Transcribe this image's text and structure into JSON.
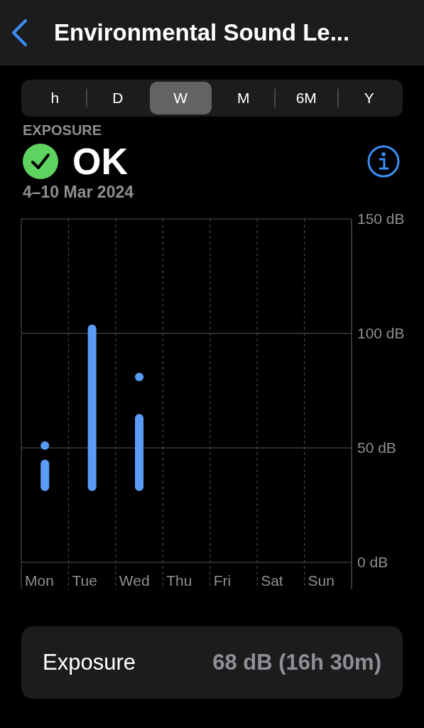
{
  "header": {
    "title": "Environmental Sound Le..."
  },
  "tabs": [
    {
      "label": "h",
      "selected": false
    },
    {
      "label": "D",
      "selected": false
    },
    {
      "label": "W",
      "selected": true
    },
    {
      "label": "M",
      "selected": false
    },
    {
      "label": "6M",
      "selected": false
    },
    {
      "label": "Y",
      "selected": false
    }
  ],
  "summary": {
    "label": "EXPOSURE",
    "status": "OK",
    "date_range": "4–10 Mar 2024"
  },
  "chart_data": {
    "type": "scatter",
    "categories": [
      "Mon",
      "Tue",
      "Wed",
      "Thu",
      "Fri",
      "Sat",
      "Sun"
    ],
    "ylim": [
      0,
      150
    ],
    "yticks": [
      {
        "value": 0,
        "label": "0 dB"
      },
      {
        "value": 50,
        "label": "50 dB"
      },
      {
        "value": 100,
        "label": "100 dB"
      },
      {
        "value": 150,
        "label": "150 dB"
      }
    ],
    "series": [
      {
        "color": "#5a9cf5",
        "values": [
          33,
          33,
          33,
          null,
          null,
          null,
          null
        ]
      },
      {
        "color": "#5a9cf5",
        "values": [
          43,
          102,
          63,
          null,
          null,
          null,
          null
        ]
      },
      {
        "color": "#5a9cf5",
        "values": [
          51,
          null,
          81,
          null,
          null,
          null,
          null
        ]
      }
    ]
  },
  "footer": {
    "label": "Exposure",
    "value": "**68** dB (16h 30m)"
  }
}
